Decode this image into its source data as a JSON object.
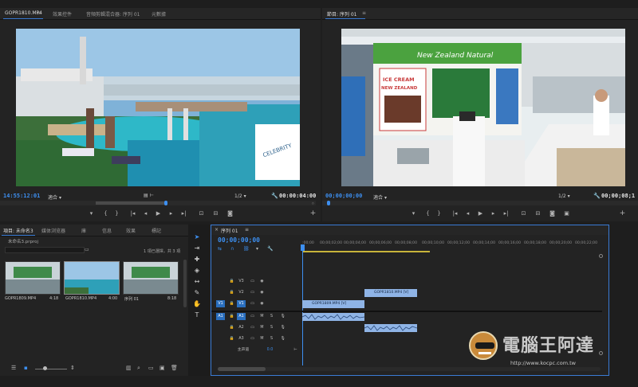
{
  "source_panel": {
    "tabs": [
      {
        "label": "GOPR1810.MP4",
        "active": true
      },
      {
        "label": "效果控件",
        "active": false
      },
      {
        "label": "音頻剪輯混合器: 序列 01",
        "active": false
      },
      {
        "label": "元數據",
        "active": false
      }
    ],
    "menu_glyph": "≡",
    "timecode": "14:55:12:01",
    "fit_label": "適合",
    "resolution_label": "1/2",
    "duration": "00:00:04:00"
  },
  "program_panel": {
    "tab": "節目: 序列 01",
    "timecode": "00;00;00;00",
    "fit_label": "適合",
    "resolution_label": "1/2",
    "duration": "00;00;08;1"
  },
  "scene": {
    "sign_text": "New Zealand Natural",
    "poster_title_1": "ICE CREAM",
    "poster_title_2": "NEW ZEALAND"
  },
  "project_panel": {
    "tabs": [
      {
        "label": "項目: 未命名3",
        "active": true
      },
      {
        "label": "媒体浏览器",
        "active": false
      },
      {
        "label": "庫",
        "active": false
      },
      {
        "label": "信息",
        "active": false
      },
      {
        "label": "效果",
        "active": false
      },
      {
        "label": "標記",
        "active": false
      }
    ],
    "file_name": "未命名3.prproj",
    "selection_info": "1 項已選擇，共 3 項",
    "items": [
      {
        "name": "GOPR1809.MP4",
        "duration": "4:18"
      },
      {
        "name": "GOPR1810.MP4",
        "duration": "4:00"
      },
      {
        "name": "序列 01",
        "duration": "8:18"
      }
    ]
  },
  "timeline": {
    "tab": "序列 01",
    "timecode": "00;00;00;00",
    "ruler": [
      ":00;00",
      "00;00;02;00",
      "00;00;04;00",
      "00;00;06;00",
      "00;00;08;00",
      "00;00;10;00",
      "00;00;12;00",
      "00;00;14;00",
      "00;00;16;00",
      "00;00;18;00",
      "00;00;20;00",
      "00;00;22;00"
    ],
    "video_tracks": [
      {
        "target": "",
        "name": "V3"
      },
      {
        "target": "",
        "name": "V2"
      },
      {
        "target": "V1",
        "name": "V1"
      }
    ],
    "audio_tracks": [
      {
        "target": "A1",
        "name": "A1",
        "m": "M",
        "s": "S"
      },
      {
        "target": "",
        "name": "A2",
        "m": "M",
        "s": "S"
      },
      {
        "target": "",
        "name": "A3",
        "m": "M",
        "s": "S"
      }
    ],
    "master_label": "主声道",
    "master_value": "0.0",
    "clips": {
      "v1": "GOPR1809.MP4 [V]",
      "v2": "GOPR1810.MP4 [V]"
    }
  },
  "watermark": {
    "text": "電腦王阿達",
    "url": "http://www.kocpc.com.tw"
  }
}
